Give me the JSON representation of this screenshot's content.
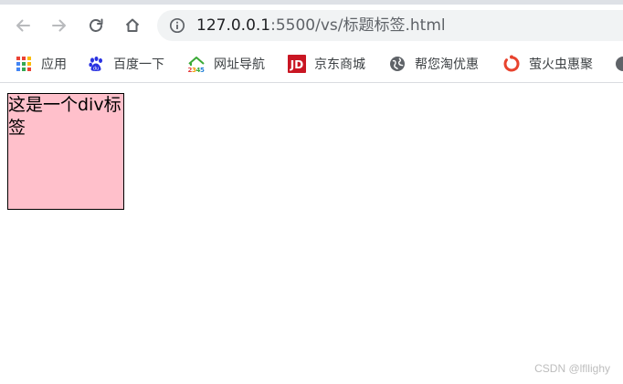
{
  "browser": {
    "url_host": "127.0.0.1",
    "url_path": ":5500/vs/标题标签.html",
    "bookmarks": [
      {
        "label": "应用",
        "icon": "apps-grid-icon"
      },
      {
        "label": "百度一下",
        "icon": "baidu-paw-icon"
      },
      {
        "label": "网址导航",
        "icon": "2345-house-icon"
      },
      {
        "label": "京东商城",
        "icon": "jd-logo-icon"
      },
      {
        "label": "帮您淘优惠",
        "icon": "globe-icon"
      },
      {
        "label": "萤火虫惠聚",
        "icon": "firefly-ring-icon"
      }
    ]
  },
  "page": {
    "div_text": "这是一个div标签"
  },
  "watermark": "CSDN @lfllighy",
  "colors": {
    "div_background": "#ffc0cb",
    "div_border": "#000000",
    "omnibox": "#f1f3f4"
  }
}
